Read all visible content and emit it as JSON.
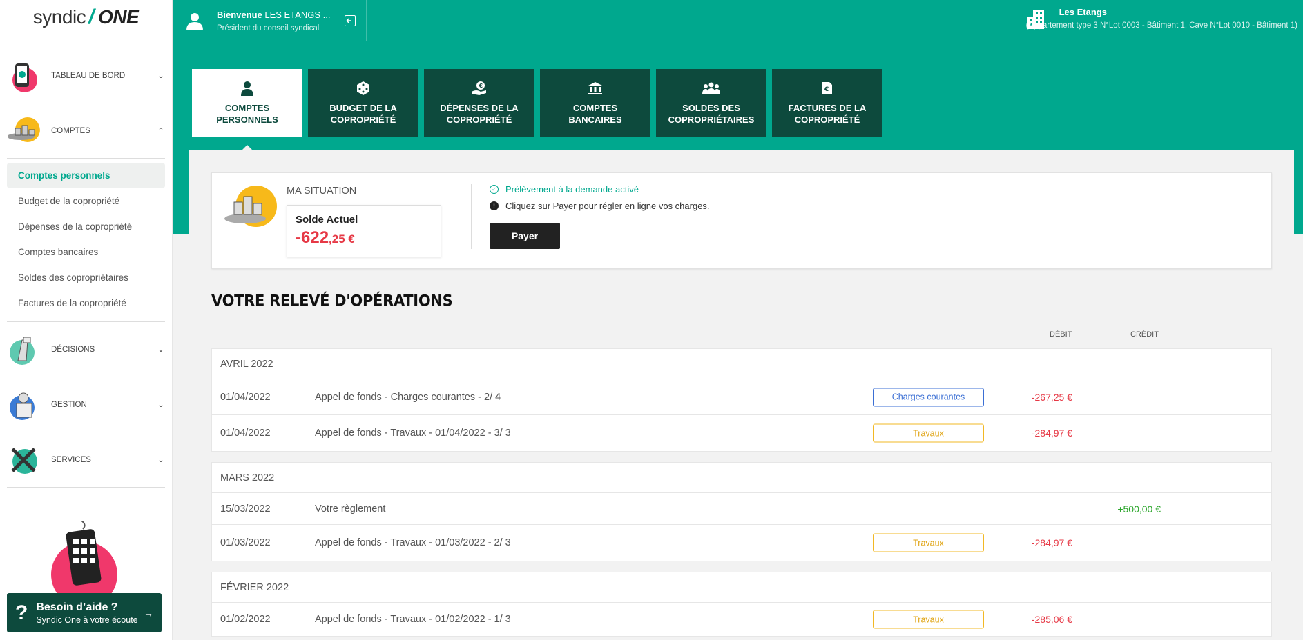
{
  "brand": {
    "syndic": "syndic",
    "one": "ONE"
  },
  "sidebar": {
    "sections": [
      {
        "label": "TABLEAU DE BORD",
        "chevron": "⌄"
      },
      {
        "label": "COMPTES",
        "chevron": "⌃"
      },
      {
        "label": "DÉCISIONS",
        "chevron": "⌄"
      },
      {
        "label": "GESTION",
        "chevron": "⌄"
      },
      {
        "label": "SERVICES",
        "chevron": "⌄"
      }
    ],
    "subnav": [
      "Comptes personnels",
      "Budget de la copropriété",
      "Dépenses de la copropriété",
      "Comptes bancaires",
      "Soldes des copropriétaires",
      "Factures de la copropriété"
    ],
    "help": {
      "icon": "?",
      "title": "Besoin d’aide ?",
      "subtitle": "Syndic One à votre écoute",
      "arrow": "→"
    }
  },
  "header": {
    "welcome_bold": "Bienvenue",
    "welcome_name": "LES ETANGS ...",
    "role": "Président du conseil syndical",
    "residence_name": "Les Etangs",
    "residence_detail": "(Appartement type 3 N°Lot 0003 - Bâtiment 1, Cave N°Lot 0010 - Bâtiment 1)"
  },
  "tabs": [
    {
      "line1": "COMPTES",
      "line2": "PERSONNELS",
      "icon": "user-icon"
    },
    {
      "line1": "BUDGET DE LA",
      "line2": "COPROPRIÉTÉ",
      "icon": "dice-icon"
    },
    {
      "line1": "DÉPENSES DE LA",
      "line2": "COPROPRIÉTÉ",
      "icon": "hand-coin-icon"
    },
    {
      "line1": "COMPTES",
      "line2": "BANCAIRES",
      "icon": "bank-icon"
    },
    {
      "line1": "SOLDES DES",
      "line2": "COPROPRIÉTAIRES",
      "icon": "people-icon"
    },
    {
      "line1": "FACTURES DE LA",
      "line2": "COPROPRIÉTÉ",
      "icon": "invoice-icon"
    }
  ],
  "situation": {
    "title": "MA SITUATION",
    "balance_label": "Solde Actuel",
    "balance_int": "-622",
    "balance_dec": ",25 €",
    "notice_active": "Prélèvement à la demande activé",
    "notice_pay": "Cliquez sur Payer pour régler en ligne vos charges.",
    "pay_button": "Payer"
  },
  "releve": {
    "title": "VOTRE RELEVÉ D'OPÉRATIONS",
    "col_debit": "DÉBIT",
    "col_credit": "CRÉDIT",
    "months": [
      {
        "month": "AVRIL 2022",
        "rows": [
          {
            "date": "01/04/2022",
            "label": "Appel de fonds - Charges courantes - 2/ 4",
            "tag": "Charges courantes",
            "debit": "-267,25 €",
            "credit": ""
          },
          {
            "date": "01/04/2022",
            "label": "Appel de fonds - Travaux - 01/04/2022 - 3/ 3",
            "tag": "Travaux",
            "debit": "-284,97 €",
            "credit": ""
          }
        ]
      },
      {
        "month": "MARS 2022",
        "rows": [
          {
            "date": "15/03/2022",
            "label": "Votre règlement",
            "tag": "",
            "debit": "",
            "credit": "+500,00 €"
          },
          {
            "date": "01/03/2022",
            "label": "Appel de fonds - Travaux - 01/03/2022 - 2/ 3",
            "tag": "Travaux",
            "debit": "-284,97 €",
            "credit": ""
          }
        ]
      },
      {
        "month": "FÉVRIER 2022",
        "rows": [
          {
            "date": "01/02/2022",
            "label": "Appel de fonds - Travaux - 01/02/2022 - 1/ 3",
            "tag": "Travaux",
            "debit": "-285,06 €",
            "credit": ""
          }
        ]
      }
    ]
  },
  "colors": {
    "primary": "#00a88e",
    "dark": "#0d4a3d",
    "debit": "#e63946",
    "credit": "#2aa52a",
    "tag_blue": "#3b6fd4",
    "tag_yellow": "#f2b824"
  }
}
